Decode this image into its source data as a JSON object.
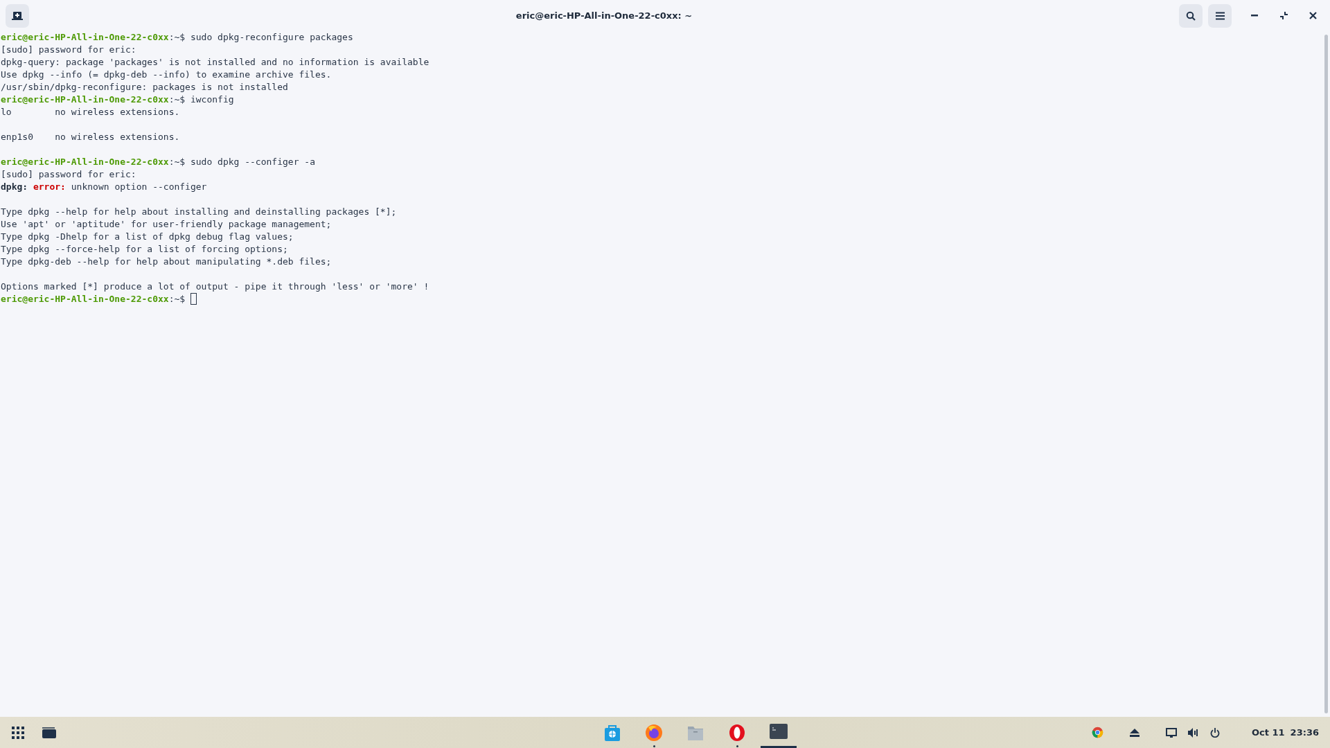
{
  "window": {
    "title": "eric@eric-HP-All-in-One-22-c0xx: ~"
  },
  "terminal": {
    "lines": [
      {
        "kind": "text",
        "segments": [
          {
            "kind": "prompt",
            "text": "eric@eric-HP-All-in-One-22-c0xx"
          },
          {
            "kind": "plain",
            "text": ":~$ sudo dpkg-reconfigure packages"
          }
        ]
      },
      {
        "kind": "text",
        "segments": [
          {
            "kind": "plain",
            "text": "[sudo] password for eric:"
          }
        ]
      },
      {
        "kind": "text",
        "segments": [
          {
            "kind": "plain",
            "text": "dpkg-query: package 'packages' is not installed and no information is available"
          }
        ]
      },
      {
        "kind": "text",
        "segments": [
          {
            "kind": "plain",
            "text": "Use dpkg --info (= dpkg-deb --info) to examine archive files."
          }
        ]
      },
      {
        "kind": "text",
        "segments": [
          {
            "kind": "plain",
            "text": "/usr/sbin/dpkg-reconfigure: packages is not installed"
          }
        ]
      },
      {
        "kind": "text",
        "segments": [
          {
            "kind": "prompt",
            "text": "eric@eric-HP-All-in-One-22-c0xx"
          },
          {
            "kind": "plain",
            "text": ":~$ iwconfig"
          }
        ]
      },
      {
        "kind": "text",
        "segments": [
          {
            "kind": "plain",
            "text": "lo        no wireless extensions."
          }
        ]
      },
      {
        "kind": "blank"
      },
      {
        "kind": "text",
        "segments": [
          {
            "kind": "plain",
            "text": "enp1s0    no wireless extensions."
          }
        ]
      },
      {
        "kind": "blank"
      },
      {
        "kind": "text",
        "segments": [
          {
            "kind": "prompt",
            "text": "eric@eric-HP-All-in-One-22-c0xx"
          },
          {
            "kind": "plain",
            "text": ":~$ sudo dpkg --configer -a"
          }
        ]
      },
      {
        "kind": "text",
        "segments": [
          {
            "kind": "plain",
            "text": "[sudo] password for eric:"
          }
        ]
      },
      {
        "kind": "text",
        "segments": [
          {
            "kind": "bold",
            "text": "dpkg: "
          },
          {
            "kind": "error",
            "text": "error:"
          },
          {
            "kind": "plain",
            "text": " unknown option --configer"
          }
        ]
      },
      {
        "kind": "blank"
      },
      {
        "kind": "text",
        "segments": [
          {
            "kind": "plain",
            "text": "Type dpkg --help for help about installing and deinstalling packages [*];"
          }
        ]
      },
      {
        "kind": "text",
        "segments": [
          {
            "kind": "plain",
            "text": "Use 'apt' or 'aptitude' for user-friendly package management;"
          }
        ]
      },
      {
        "kind": "text",
        "segments": [
          {
            "kind": "plain",
            "text": "Type dpkg -Dhelp for a list of dpkg debug flag values;"
          }
        ]
      },
      {
        "kind": "text",
        "segments": [
          {
            "kind": "plain",
            "text": "Type dpkg --force-help for a list of forcing options;"
          }
        ]
      },
      {
        "kind": "text",
        "segments": [
          {
            "kind": "plain",
            "text": "Type dpkg-deb --help for help about manipulating *.deb files;"
          }
        ]
      },
      {
        "kind": "blank"
      },
      {
        "kind": "text",
        "segments": [
          {
            "kind": "plain",
            "text": "Options marked [*] produce a lot of output - pipe it through 'less' or 'more' !"
          }
        ]
      },
      {
        "kind": "text",
        "cursor": true,
        "segments": [
          {
            "kind": "prompt",
            "text": "eric@eric-HP-All-in-One-22-c0xx"
          },
          {
            "kind": "plain",
            "text": ":~$ "
          }
        ]
      }
    ]
  },
  "taskbar": {
    "apps": [
      {
        "kind": "store",
        "running": false,
        "active": false
      },
      {
        "kind": "firefox",
        "running": true,
        "active": false
      },
      {
        "kind": "files",
        "running": false,
        "active": false
      },
      {
        "kind": "opera",
        "running": true,
        "active": false
      },
      {
        "kind": "terminal",
        "running": false,
        "active": true
      }
    ],
    "tray": {
      "date": "Oct 11",
      "time": "23:36"
    }
  }
}
